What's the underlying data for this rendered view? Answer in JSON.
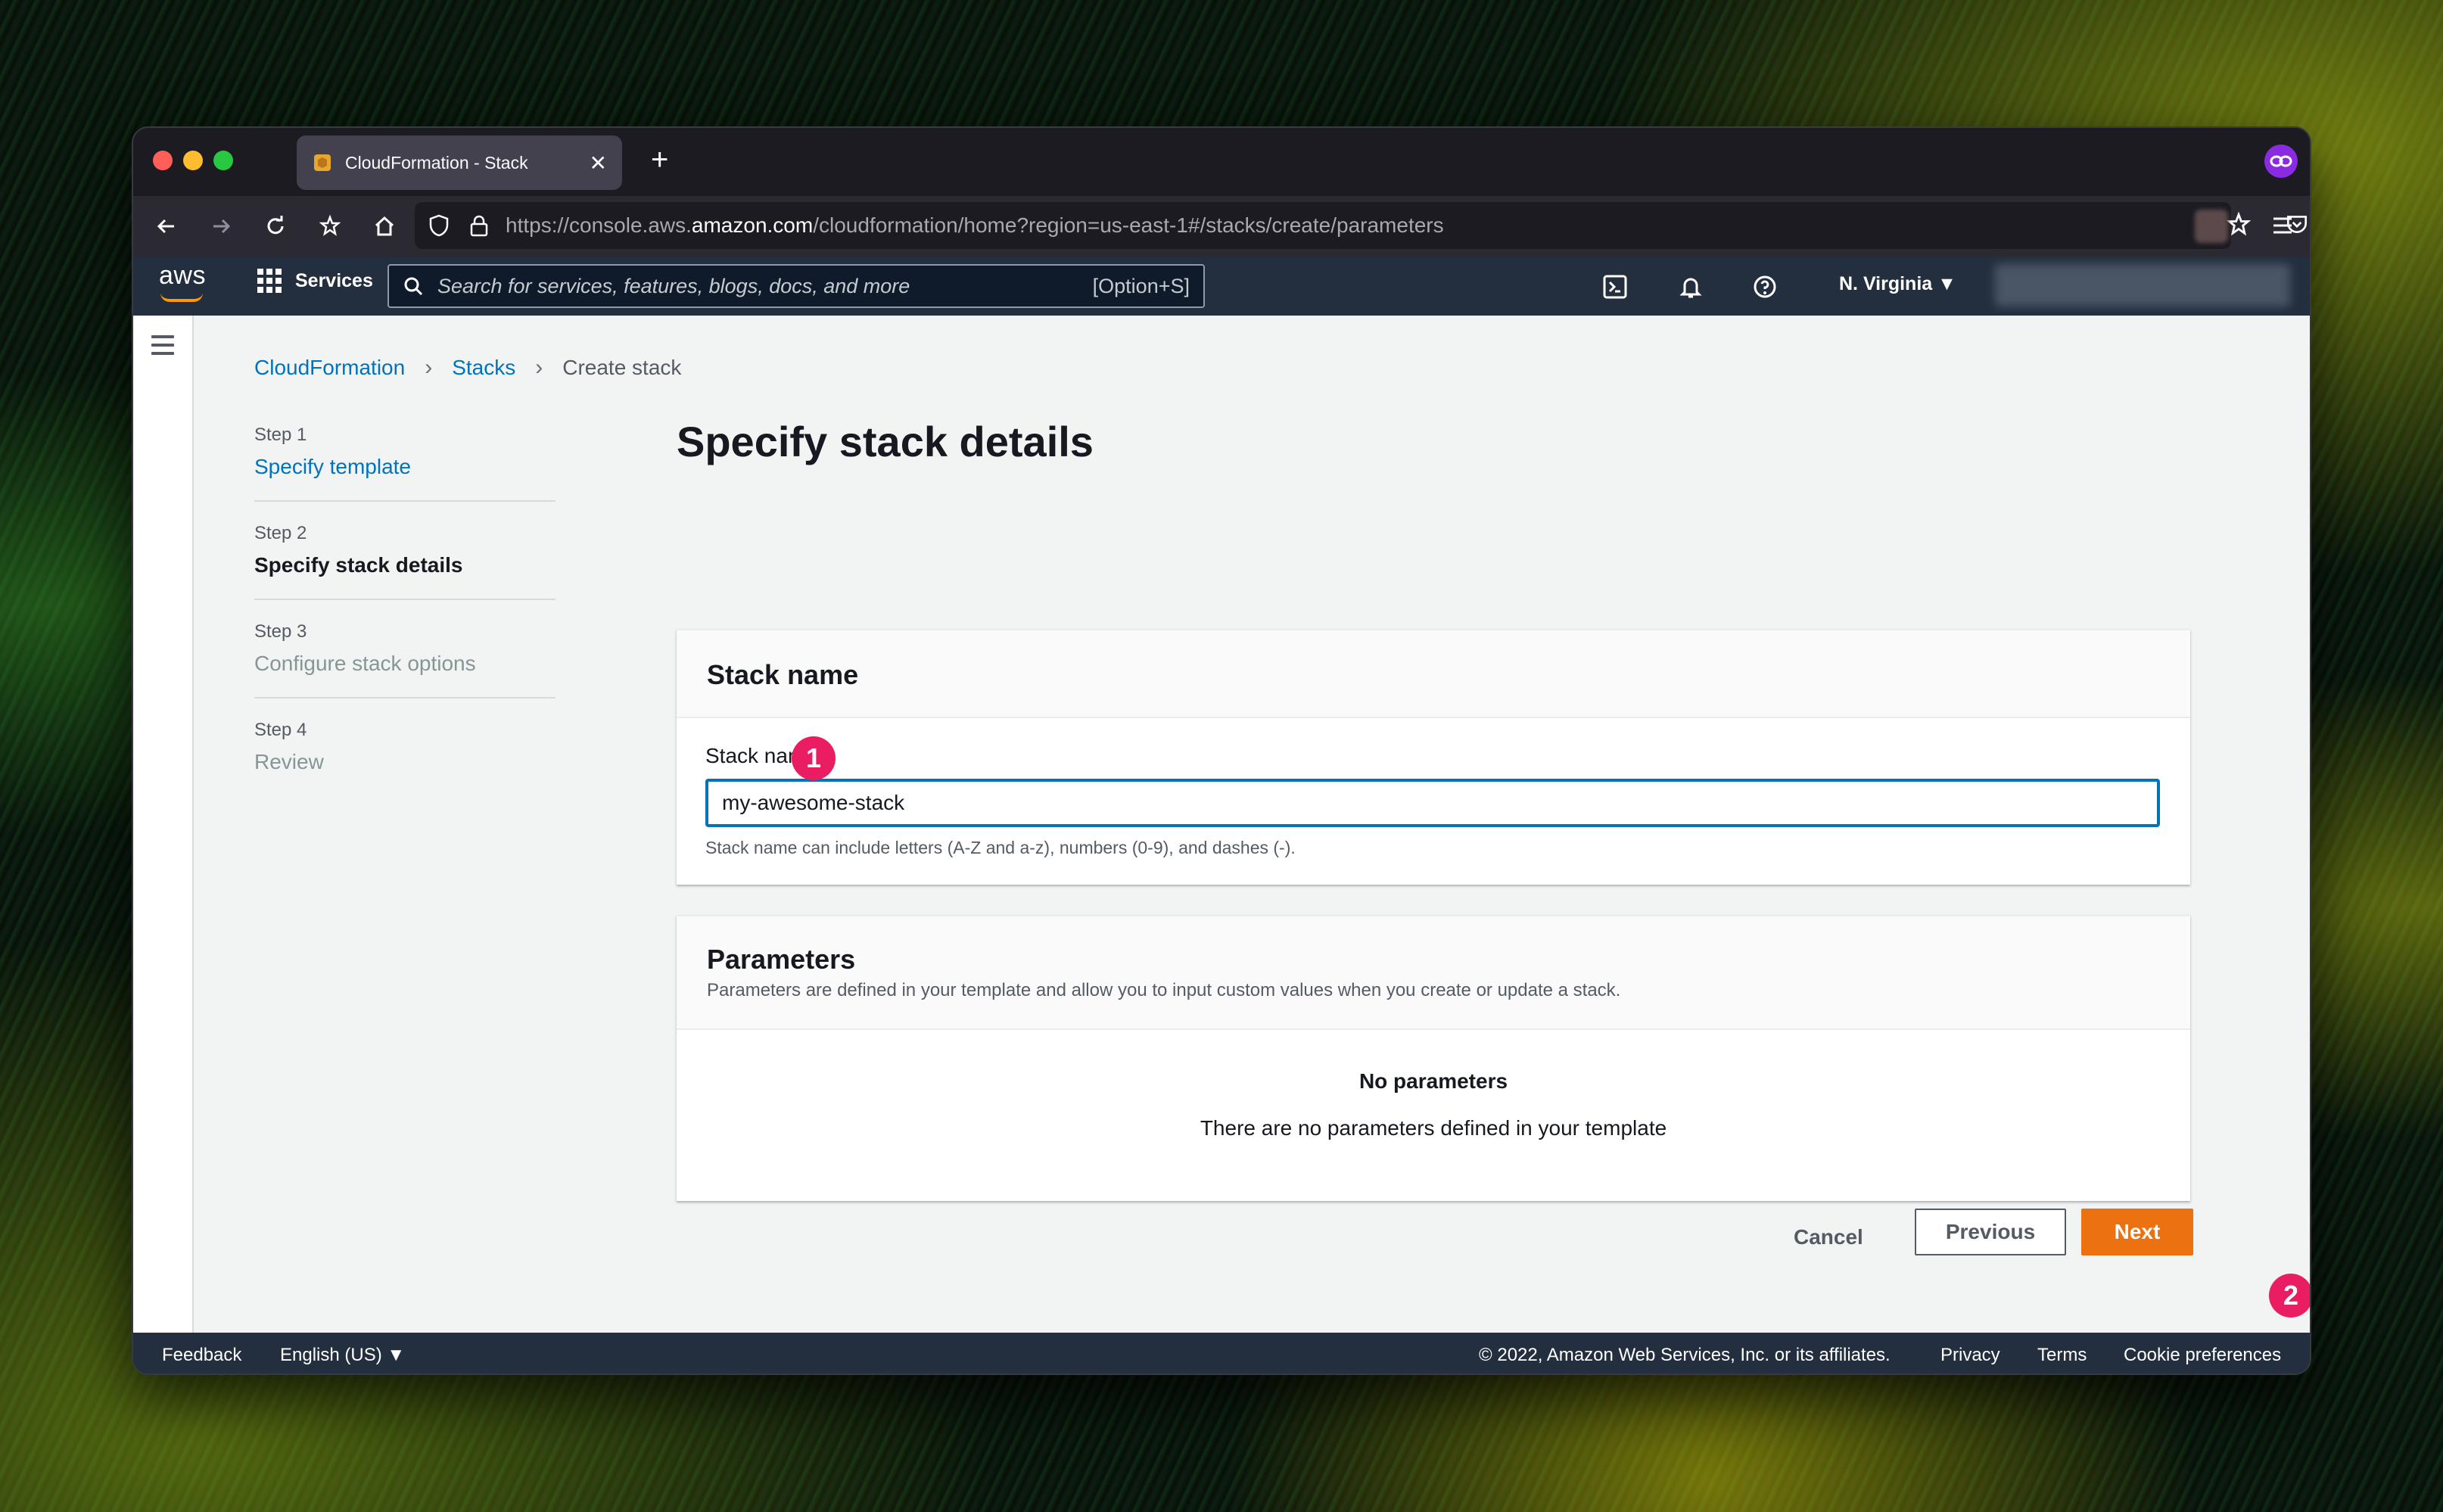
{
  "browser": {
    "tab_title": "CloudFormation - Stack",
    "url_prefix": "https://console.aws.",
    "url_host": "amazon.com",
    "url_path": "/cloudformation/home?region=us-east-1#/stacks/create/parameters"
  },
  "aws_header": {
    "logo": "aws",
    "services_label": "Services",
    "search_placeholder": "Search for services, features, blogs, docs, and more",
    "search_shortcut": "[Option+S]",
    "region": "N. Virginia ▼"
  },
  "breadcrumb": {
    "items": [
      "CloudFormation",
      "Stacks",
      "Create stack"
    ]
  },
  "wizard_steps": [
    {
      "num": "Step 1",
      "title": "Specify template",
      "state": "link"
    },
    {
      "num": "Step 2",
      "title": "Specify stack details",
      "state": "active"
    },
    {
      "num": "Step 3",
      "title": "Configure stack options",
      "state": "disabled"
    },
    {
      "num": "Step 4",
      "title": "Review",
      "state": "disabled"
    }
  ],
  "page": {
    "title": "Specify stack details"
  },
  "stack_name_panel": {
    "heading": "Stack name",
    "field_label": "Stack name",
    "value": "my-awesome-stack",
    "hint": "Stack name can include letters (A-Z and a-z), numbers (0-9), and dashes (-)."
  },
  "parameters_panel": {
    "heading": "Parameters",
    "description": "Parameters are defined in your template and allow you to input custom values when you create or update a stack.",
    "empty_title": "No parameters",
    "empty_description": "There are no parameters defined in your template"
  },
  "actions": {
    "cancel": "Cancel",
    "previous": "Previous",
    "next": "Next"
  },
  "markers": {
    "one": "1",
    "two": "2"
  },
  "footer": {
    "feedback": "Feedback",
    "language": "English (US) ▼",
    "copyright": "© 2022, Amazon Web Services, Inc. or its affiliates.",
    "privacy": "Privacy",
    "terms": "Terms",
    "cookies": "Cookie preferences"
  },
  "colors": {
    "aws_navy": "#232f3e",
    "link_blue": "#0073bb",
    "primary_orange": "#ec7211",
    "marker_pink": "#ea1d63"
  }
}
